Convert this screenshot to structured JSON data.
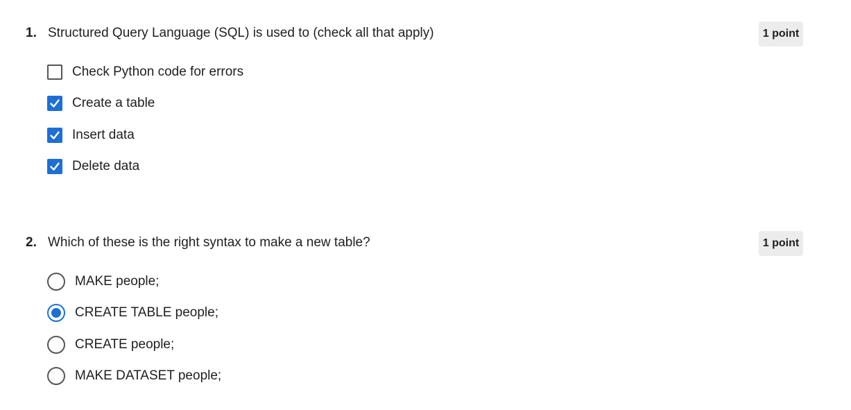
{
  "questions": [
    {
      "number": "1.",
      "text": "Structured Query Language (SQL) is used to (check all that apply)",
      "points": "1 point",
      "type": "checkbox",
      "options": [
        {
          "label": "Check Python code for errors",
          "checked": false
        },
        {
          "label": "Create a table",
          "checked": true
        },
        {
          "label": "Insert data",
          "checked": true
        },
        {
          "label": "Delete data",
          "checked": true
        }
      ]
    },
    {
      "number": "2.",
      "text": "Which of these is the right syntax to make a new table?",
      "points": "1 point",
      "type": "radio",
      "options": [
        {
          "label": "MAKE people;",
          "checked": false
        },
        {
          "label": "CREATE TABLE people;",
          "checked": true
        },
        {
          "label": "CREATE people;",
          "checked": false
        },
        {
          "label": "MAKE DATASET people;",
          "checked": false
        }
      ]
    }
  ],
  "colors": {
    "accent": "#1d6fd6",
    "badge_bg": "#ececec",
    "text": "#1f1f1f",
    "control_border": "#555555"
  },
  "icons": {
    "checkbox_checked": "checkmark-icon",
    "radio_selected": "radio-dot-icon"
  }
}
